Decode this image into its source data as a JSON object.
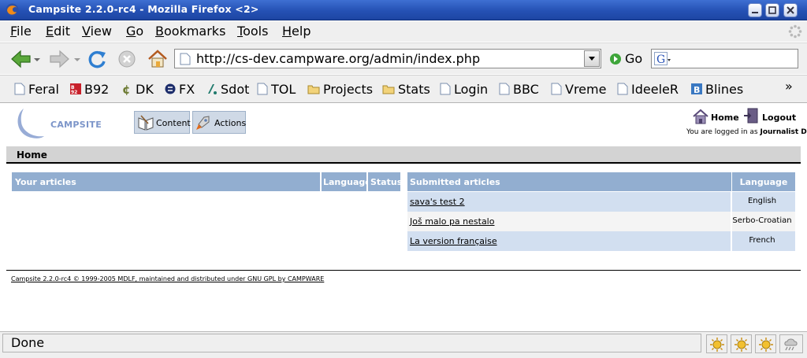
{
  "window": {
    "title": "Campsite 2.2.0-rc4 - Mozilla Firefox <2>"
  },
  "menu": {
    "items": [
      {
        "accel": "F",
        "rest": "ile"
      },
      {
        "accel": "E",
        "rest": "dit"
      },
      {
        "accel": "V",
        "rest": "iew"
      },
      {
        "accel": "G",
        "rest": "o"
      },
      {
        "accel": "B",
        "rest": "ookmarks"
      },
      {
        "accel": "T",
        "rest": "ools"
      },
      {
        "accel": "H",
        "rest": "elp"
      }
    ]
  },
  "navigation": {
    "url": "http://cs-dev.campware.org/admin/index.php",
    "go_label": "Go",
    "search_value": ""
  },
  "bookmarks": {
    "items": [
      {
        "label": "Feral",
        "icon": "page-icon"
      },
      {
        "label": "B92",
        "icon": "b92-icon"
      },
      {
        "label": "DK",
        "icon": "dk-icon"
      },
      {
        "label": "FX",
        "icon": "fx-icon"
      },
      {
        "label": "Sdot",
        "icon": "sdot-icon"
      },
      {
        "label": "TOL",
        "icon": "page-icon"
      },
      {
        "label": "Projects",
        "icon": "folder-icon"
      },
      {
        "label": "Stats",
        "icon": "folder-icon"
      },
      {
        "label": "Login",
        "icon": "page-icon"
      },
      {
        "label": "BBC",
        "icon": "page-icon"
      },
      {
        "label": "Vreme",
        "icon": "page-icon"
      },
      {
        "label": "IdeeleR",
        "icon": "page-icon"
      },
      {
        "label": "Blines",
        "icon": "blines-icon"
      }
    ],
    "more": "»"
  },
  "campsite": {
    "logo_text": "CAMPSITE",
    "content_label": "Content",
    "actions_label": "Actions",
    "home_link": "Home",
    "logout_link": "Logout",
    "logged_in_prefix": "You are logged in as ",
    "user_name": "Journalist Doe",
    "section_title": "Home",
    "your_articles": {
      "headers": [
        "Your articles",
        "Language",
        "Status"
      ]
    },
    "submitted_articles": {
      "headers": [
        "Submitted articles",
        "Language"
      ],
      "rows": [
        {
          "title": "sava's test 2",
          "language": "English"
        },
        {
          "title": "Još malo pa nestalo",
          "language": "Serbo-Croatian"
        },
        {
          "title": "La version française",
          "language": "French"
        }
      ]
    },
    "footer": "Campsite 2.2.0-rc4 © 1999-2005 MDLF, maintained and distributed under GNU GPL by CAMPWARE"
  },
  "status": {
    "text": "Done"
  },
  "colors": {
    "titlebar": "#2a59c0",
    "table_header": "#92aed0",
    "row_even": "#d2dff0",
    "row_odd": "#f4f4f4"
  }
}
